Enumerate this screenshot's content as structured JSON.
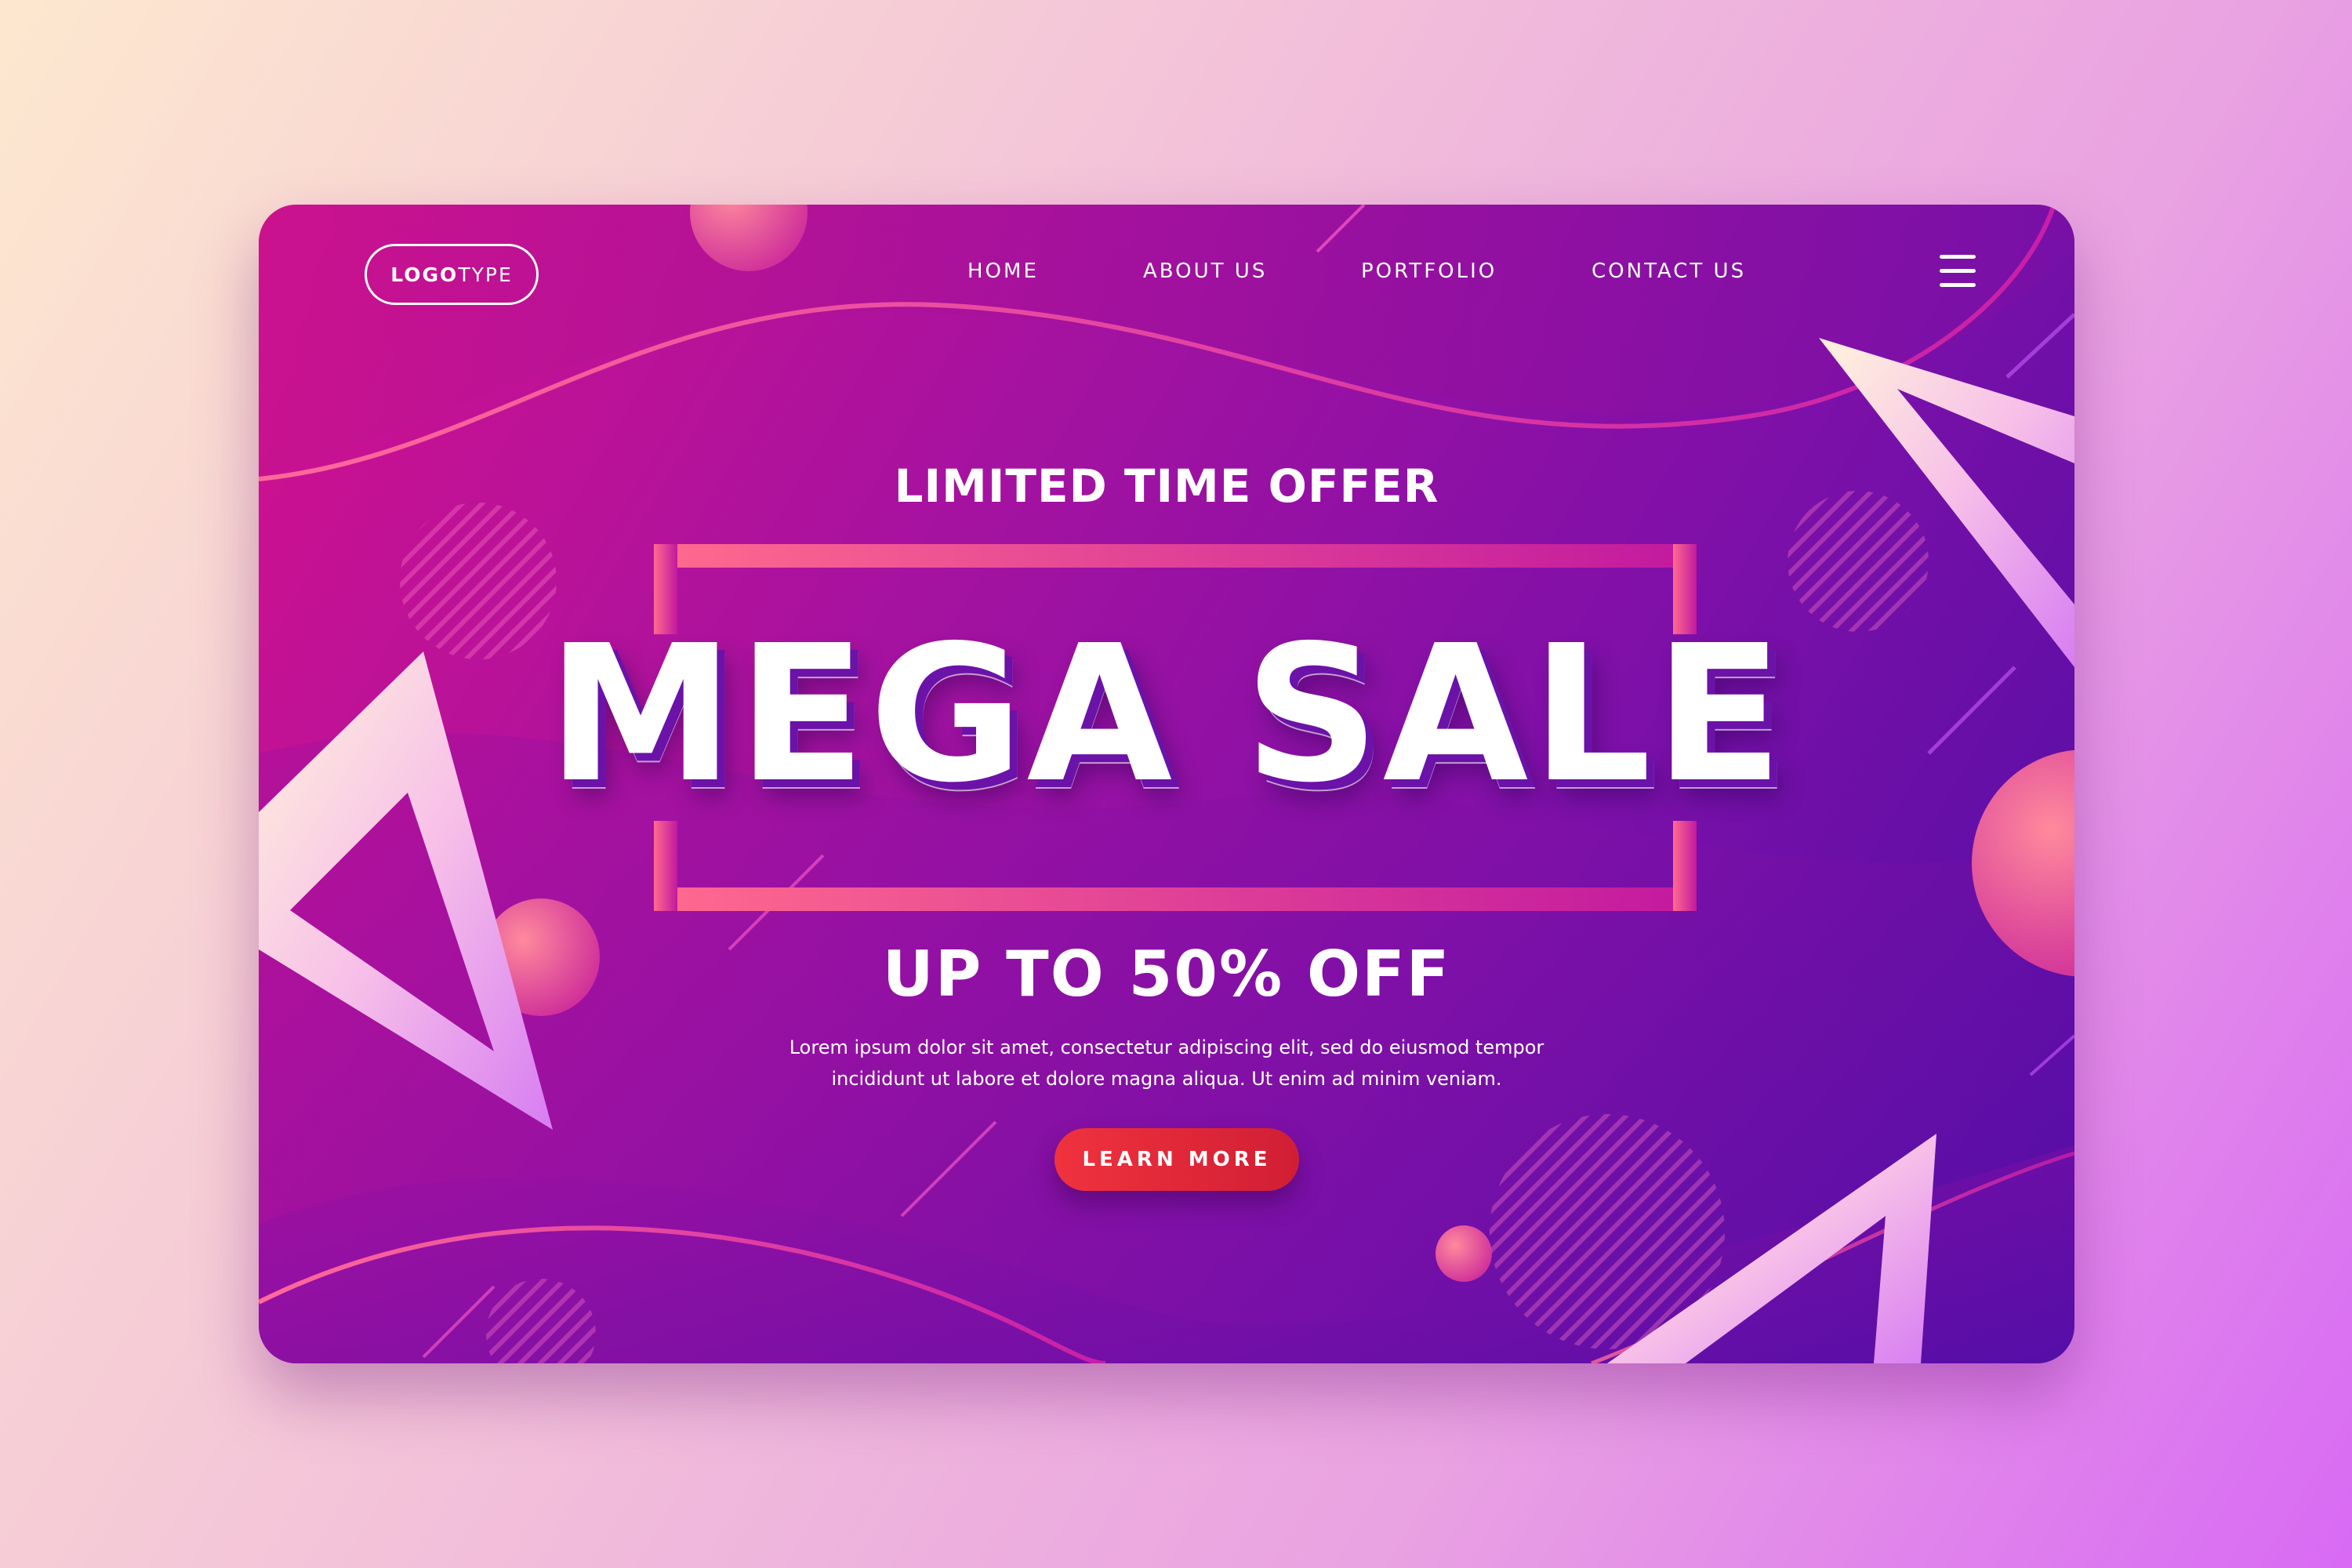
{
  "logo": {
    "bold": "LOGO",
    "light": "TYPE"
  },
  "nav": {
    "items": [
      "HOME",
      "ABOUT US",
      "PORTFOLIO",
      "CONTACT US"
    ]
  },
  "hero": {
    "eyebrow": "LIMITED TIME OFFER",
    "title": "MEGA SALE",
    "subtitle": "UP TO 50% OFF",
    "body_line1": "Lorem ipsum dolor sit amet, consectetur adipiscing elit, sed do eiusmod tempor",
    "body_line2": "incididunt ut labore et dolore magna aliqua. Ut enim ad minim veniam.",
    "cta": "LEARN MORE"
  },
  "icons": {
    "menu": "hamburger-menu-icon"
  },
  "colors": {
    "background_start": "#fde8cf",
    "background_end": "#d86af4",
    "card_start": "#d2118e",
    "card_end": "#4b0ea6",
    "cta": "#e52a3a",
    "frame_accent": "#ff6a8e"
  }
}
